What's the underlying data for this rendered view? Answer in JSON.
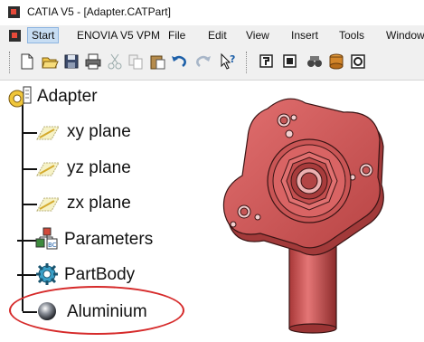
{
  "window": {
    "title": "CATIA V5 - [Adapter.CATPart]"
  },
  "menu": {
    "items": [
      "Start",
      "ENOVIA V5 VPM",
      "File",
      "Edit",
      "View",
      "Insert",
      "Tools",
      "Window"
    ]
  },
  "toolbar": {
    "buttons": [
      "new-icon",
      "open-icon",
      "save-icon",
      "print-icon",
      "cut-icon",
      "copy-icon",
      "paste-icon",
      "undo-icon",
      "redo-icon",
      "whats-this-icon",
      "sketcher-icon",
      "view-icon",
      "analysis-icon",
      "catalog-icon",
      "render-icon"
    ]
  },
  "tree": {
    "root": "Adapter",
    "planes": [
      "xy plane",
      "yz plane",
      "zx plane"
    ],
    "parameters": "Parameters",
    "partbody": "PartBody",
    "material": "Aluminium"
  },
  "colors": {
    "part": "#d15a5a",
    "highlight": "#d62b2b",
    "menu_active": "#c7ddf3"
  }
}
